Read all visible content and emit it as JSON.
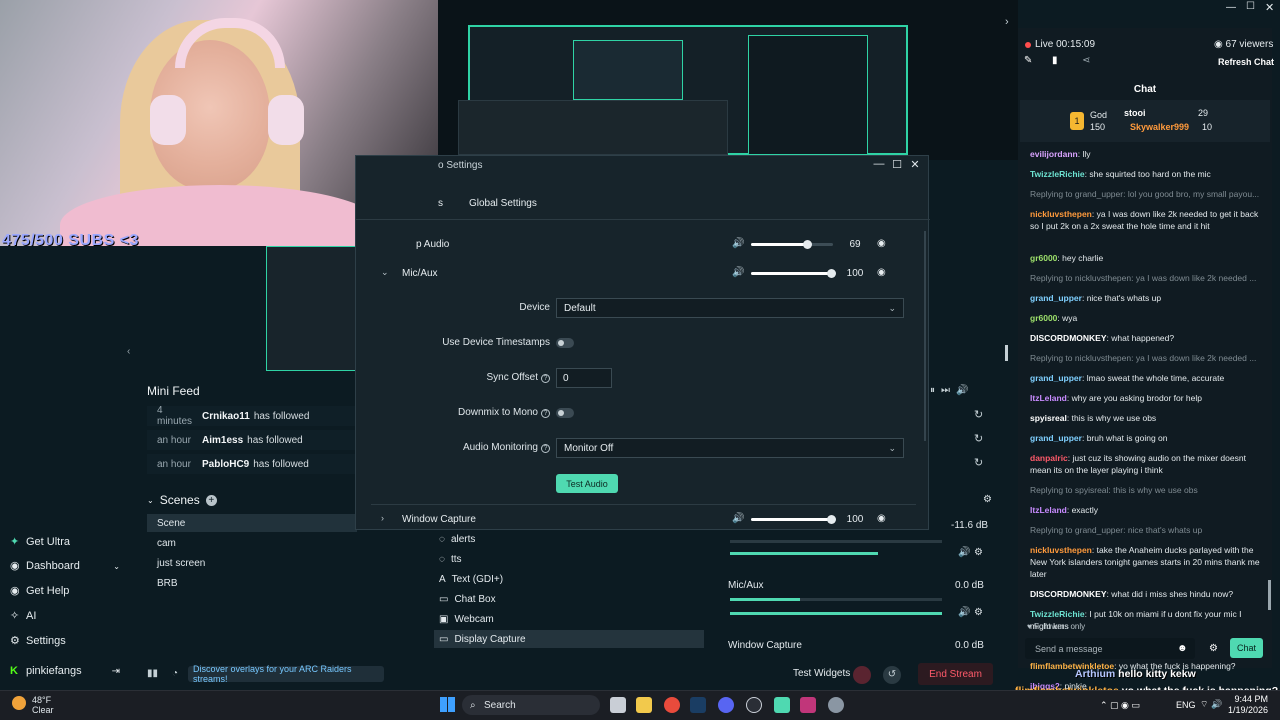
{
  "webcam": {
    "overlay_text": "475/500 SUBS <3"
  },
  "nav": {
    "items": [
      {
        "label": "Get Ultra",
        "icon": "ultra-icon"
      },
      {
        "label": "Dashboard",
        "icon": "dashboard-icon"
      },
      {
        "label": "Get Help",
        "icon": "help-icon"
      },
      {
        "label": "AI",
        "icon": "ai-icon"
      },
      {
        "label": "Settings",
        "icon": "gear-icon"
      }
    ],
    "user": "pinkiefangs"
  },
  "mini_feed": {
    "title": "Mini Feed",
    "events": [
      {
        "time": "4 minutes",
        "user": "Crnikao11",
        "action": "has followed"
      },
      {
        "time": "an hour",
        "user": "Aim1ess",
        "action": "has followed"
      },
      {
        "time": "an hour",
        "user": "PabloHC9",
        "action": "has followed"
      }
    ]
  },
  "scenes": {
    "title": "Scenes",
    "items": [
      "Scene",
      "cam",
      "just screen",
      "BRB"
    ],
    "selected": "Scene"
  },
  "sources": {
    "items": [
      "alerts",
      "tts",
      "Text (GDI+)",
      "Chat Box",
      "Webcam",
      "Display Capture"
    ],
    "selected": "Display Capture"
  },
  "mixer": {
    "top_db": "-11.6 dB",
    "channels": [
      {
        "name": "Mic/Aux",
        "db": "0.0 dB"
      },
      {
        "name": "Window Capture",
        "db": "0.0 dB"
      }
    ]
  },
  "dialog": {
    "title": "o Settings",
    "tabs": [
      "s",
      "Global Settings"
    ],
    "channels": [
      {
        "name": "p Audio",
        "volume": 69
      },
      {
        "name": "Mic/Aux",
        "volume": 100
      },
      {
        "name": "Window Capture",
        "volume": 100
      }
    ],
    "device_label": "Device",
    "device_value": "Default",
    "timestamps_label": "Use Device Timestamps",
    "sync_label": "Sync Offset",
    "sync_value": "0",
    "downmix_label": "Downmix to Mono",
    "monitoring_label": "Audio Monitoring",
    "monitoring_value": "Monitor Off",
    "test_button": "Test Audio"
  },
  "chat": {
    "live_time": "Live 00:15:09",
    "viewers": "67 viewers",
    "refresh": "Refresh Chat",
    "title": "Chat",
    "leaders": [
      {
        "rank": "God",
        "points": "150"
      },
      {
        "name": "stooi",
        "points": "29"
      },
      {
        "name": "Skywalker999",
        "points": "10"
      }
    ],
    "messages": [
      {
        "user": "evilijordann",
        "text": "lly",
        "color": "#d9a3ff"
      },
      {
        "user": "TwizzleRichie",
        "text": "she squirted too hard on the mic",
        "color": "#6de3d2"
      },
      {
        "reply": "Replying to grand_upper: lol you good bro, my small payou..."
      },
      {
        "user": "nickluvsthepen",
        "text": "ya I was down like 2k needed to get it back so I put 2k on a 2x sweat the hole time and it hit",
        "color": "#ff9a3c"
      },
      {
        "user": "gr6000",
        "text": "hey charlie",
        "color": "#9de06b"
      },
      {
        "reply": "Replying to nickluvsthepen: ya I was down like 2k needed ..."
      },
      {
        "user": "grand_upper",
        "text": "nice that's whats up",
        "color": "#7fd0ff"
      },
      {
        "user": "gr6000",
        "text": "wya",
        "color": "#9de06b"
      },
      {
        "user": "DISCORDMONKEY",
        "text": "what happened?",
        "color": "#ffffff"
      },
      {
        "reply": "Replying to nickluvsthepen: ya I was down like 2k needed ..."
      },
      {
        "user": "grand_upper",
        "text": "lmao sweat the whole time, accurate",
        "color": "#7fd0ff"
      },
      {
        "user": "ItzLeland",
        "text": "why are you asking brodor for help",
        "color": "#c88bff"
      },
      {
        "user": "spyisreal",
        "text": "this is why we use obs",
        "color": "#ffffff"
      },
      {
        "user": "grand_upper",
        "text": "bruh what is going on",
        "color": "#7fd0ff"
      },
      {
        "user": "danpalric",
        "text": "just cuz its showing audio on the mixer doesnt mean its on the layer playing i think",
        "color": "#ff5a6a"
      },
      {
        "reply": "Replying to spyisreal: this is why we use obs"
      },
      {
        "user": "ItzLeland",
        "text": "exactly",
        "color": "#c88bff"
      },
      {
        "reply": "Replying to grand_upper: nice that's whats up"
      },
      {
        "user": "nickluvsthepen",
        "text": "take the Anaheim ducks parlayed with the New York islanders tonight games starts in 20 mins thank me later",
        "color": "#ff9a3c"
      },
      {
        "user": "DISCORDMONKEY",
        "text": "what did i miss shes hindu now?",
        "color": "#ffffff"
      },
      {
        "user": "TwizzleRichie",
        "text": "I put 10k on miami if u dont fix your mic I might kms",
        "color": "#6de3d2"
      },
      {
        "user": "Arthium",
        "text": "hello kitty kekw",
        "color": "#ffffff"
      },
      {
        "user": "flimflambetwinkletoe",
        "text": "yo what the fuck is happening?",
        "color": "#ffb347"
      },
      {
        "user": "jbiggs2",
        "text": "pinkie",
        "color": "#c88bff"
      }
    ],
    "followers_only": "Followers only",
    "input_placeholder": "Send a message",
    "send": "Chat"
  },
  "overlay_chat": [
    {
      "user": "Arthium",
      "text": "hello kitty kekw"
    },
    {
      "user": "flimflambetwinkletoe",
      "text": "yo what the fuck is happening?"
    },
    {
      "user": "jbiggs2",
      "text": "pinkie"
    }
  ],
  "bottom": {
    "promo": "Discover overlays for your ARC Raiders streams!",
    "test_widgets": "Test Widgets",
    "end_stream": "End Stream"
  },
  "taskbar": {
    "weather_temp": "48°F",
    "weather_desc": "Clear",
    "search": "Search",
    "lang": "ENG",
    "time": "9:44 PM",
    "date": "1/19/2026"
  }
}
